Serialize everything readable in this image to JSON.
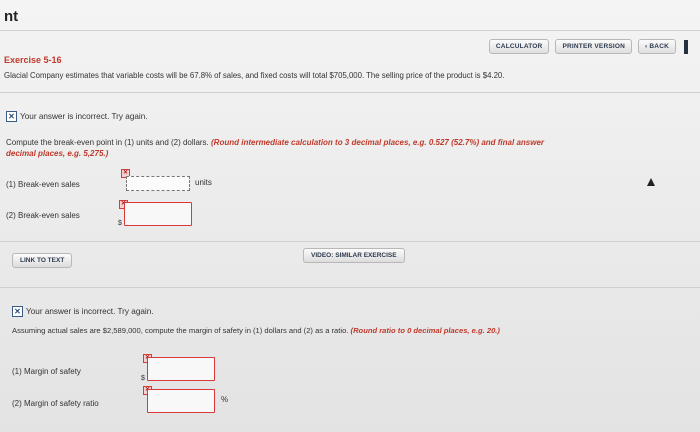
{
  "app_title": "nt",
  "toolbar": {
    "calculator": "CALCULATOR",
    "printer_version": "PRINTER VERSION",
    "back": "‹ BACK"
  },
  "exercise": {
    "title": "Exercise 5-16",
    "description": "Glacial Company estimates that variable costs will be 67.8% of sales, and fixed costs will total $705,000. The selling price of the product is $4.20."
  },
  "part1": {
    "feedback": "Your answer is incorrect.  Try again.",
    "instruction": "Compute the break-even point in (1) units and (2) dollars.",
    "rounding_1": "(Round intermediate calculation to 3 decimal places, e.g. 0.527 (52.7%) and final answer",
    "rounding_2": "decimal places, e.g. 5,275.)",
    "q1_label": "(1)  Break-even sales",
    "q1_value": "",
    "q1_unit": "units",
    "q2_label": "(2)  Break-even sales",
    "q2_prefix": "$",
    "q2_value": ""
  },
  "buttons": {
    "link_to_text": "LINK TO TEXT",
    "video_similar": "VIDEO: SIMILAR EXERCISE"
  },
  "part2": {
    "feedback": "Your answer is incorrect.  Try again.",
    "instruction": "Assuming actual sales are $2,589,000, compute the margin of safety in (1) dollars and (2) as a ratio.",
    "rounding": "(Round ratio to 0 decimal places, e.g. 20.)",
    "q1_label": "(1)  Margin of safety",
    "q1_prefix": "$",
    "q1_value": "",
    "q2_label": "(2)  Margin of safety ratio",
    "q2_value": "",
    "q2_unit": "%"
  },
  "colors": {
    "error_red": "#d63a3a",
    "exercise_title_red": "#c0392b",
    "icon_blue": "#3b5c86"
  }
}
